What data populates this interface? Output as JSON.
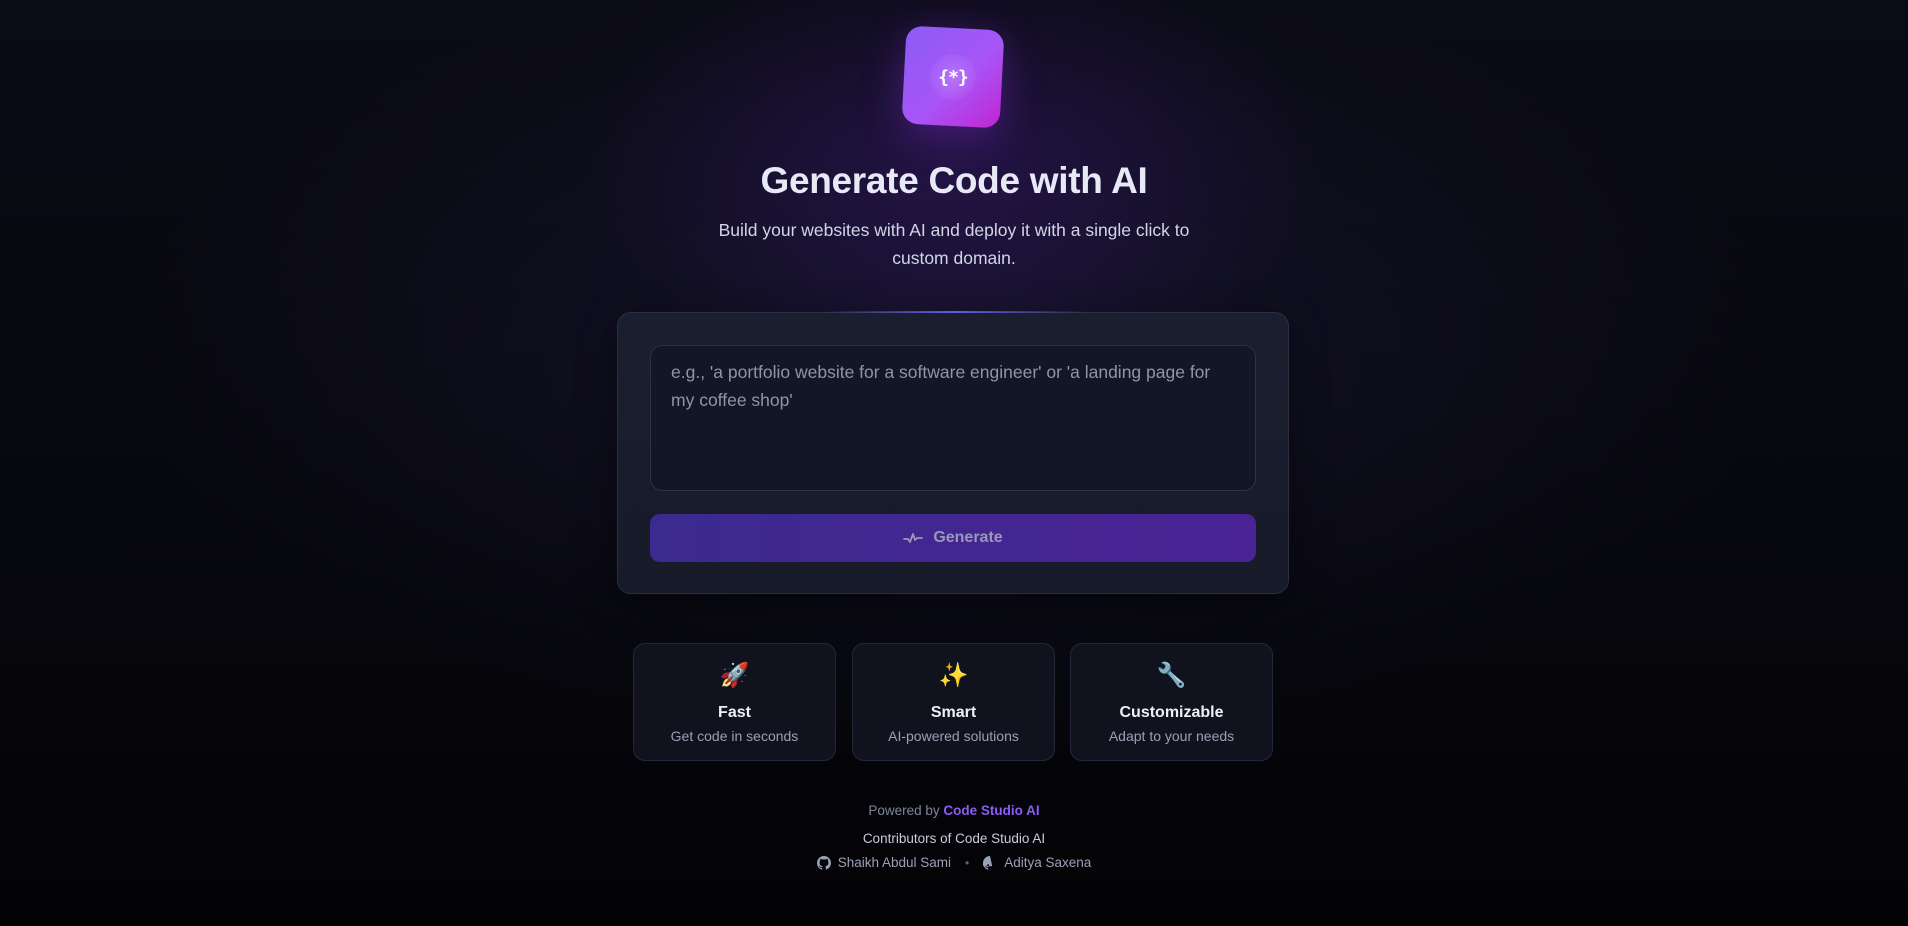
{
  "logo": {
    "glyph": "{*}",
    "icon": "code-braces-icon"
  },
  "hero": {
    "title": "Generate Code with AI",
    "subtitle": "Build your websites with AI and deploy it with a single click to custom domain."
  },
  "prompt": {
    "value": "",
    "placeholder": "e.g., 'a portfolio website for a software engineer' or 'a landing page for my coffee shop'"
  },
  "generate_button": {
    "label": "Generate",
    "icon": "sparkle-wave-icon"
  },
  "features": [
    {
      "icon": "🚀",
      "icon_name": "rocket-icon",
      "title": "Fast",
      "description": "Get code in seconds"
    },
    {
      "icon": "✨",
      "icon_name": "sparkles-icon",
      "title": "Smart",
      "description": "AI-powered solutions"
    },
    {
      "icon": "🔧",
      "icon_name": "wrench-icon",
      "title": "Customizable",
      "description": "Adapt to your needs"
    }
  ],
  "footer": {
    "powered_prefix": "Powered by",
    "powered_brand": "Code Studio AI",
    "contributors_title": "Contributors of Code Studio AI",
    "separator": "•",
    "contributors": [
      {
        "name": "Shaikh Abdul Sami",
        "icon": "github-icon"
      },
      {
        "name": "Aditya Saxena",
        "icon": "github-icon"
      }
    ]
  },
  "colors": {
    "accent": "#8b5cf6",
    "button": "#3b2a8f",
    "card": "#1a1e2e"
  }
}
